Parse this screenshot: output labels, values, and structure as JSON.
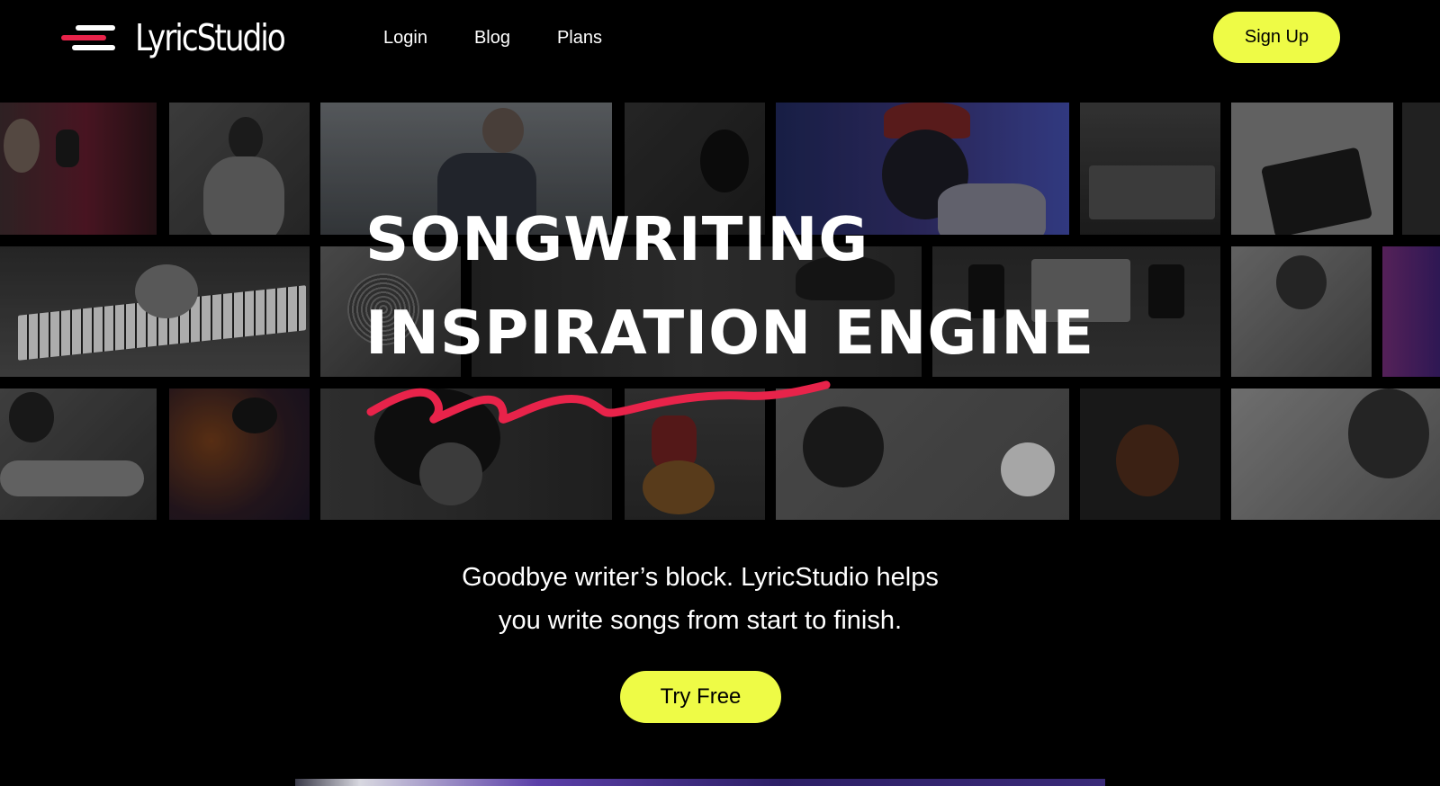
{
  "brand": {
    "name": "LyricStudio",
    "accent": "#e8234a",
    "cta_color": "#eefb46"
  },
  "nav": {
    "links": [
      {
        "label": "Login"
      },
      {
        "label": "Blog"
      },
      {
        "label": "Plans"
      }
    ],
    "signup_label": "Sign Up"
  },
  "hero": {
    "title_line1": "SONGWRITING",
    "title_line2": "INSPIRATION ENGINE",
    "subtitle_line1": "Goodbye writer’s block. LyricStudio helps",
    "subtitle_line2": "you write songs from start to finish.",
    "cta_label": "Try Free"
  },
  "photo_grid": {
    "tiles": [
      {
        "subject": "singer-at-microphone"
      },
      {
        "subject": "man-singing-studio"
      },
      {
        "subject": "guitarist-outdoors"
      },
      {
        "subject": "microphone-studio"
      },
      {
        "subject": "singer-red-cap-headphones"
      },
      {
        "subject": "mixing-console"
      },
      {
        "subject": "midi-keyboard-laptop"
      },
      {
        "subject": "mixer-edge"
      },
      {
        "subject": "piano-keys"
      },
      {
        "subject": "microphone-closeup"
      },
      {
        "subject": "man-in-hat"
      },
      {
        "subject": "home-studio-monitors"
      },
      {
        "subject": "woman-with-guitar"
      },
      {
        "subject": "purple-lit-person"
      },
      {
        "subject": "guitarist-headphones"
      },
      {
        "subject": "guitarist-orange-light"
      },
      {
        "subject": "woman-singing-eyes-closed"
      },
      {
        "subject": "woman-acoustic-guitar"
      },
      {
        "subject": "guitar-headphones-coffee"
      },
      {
        "subject": "violinist"
      },
      {
        "subject": "woman-at-mic"
      }
    ]
  }
}
